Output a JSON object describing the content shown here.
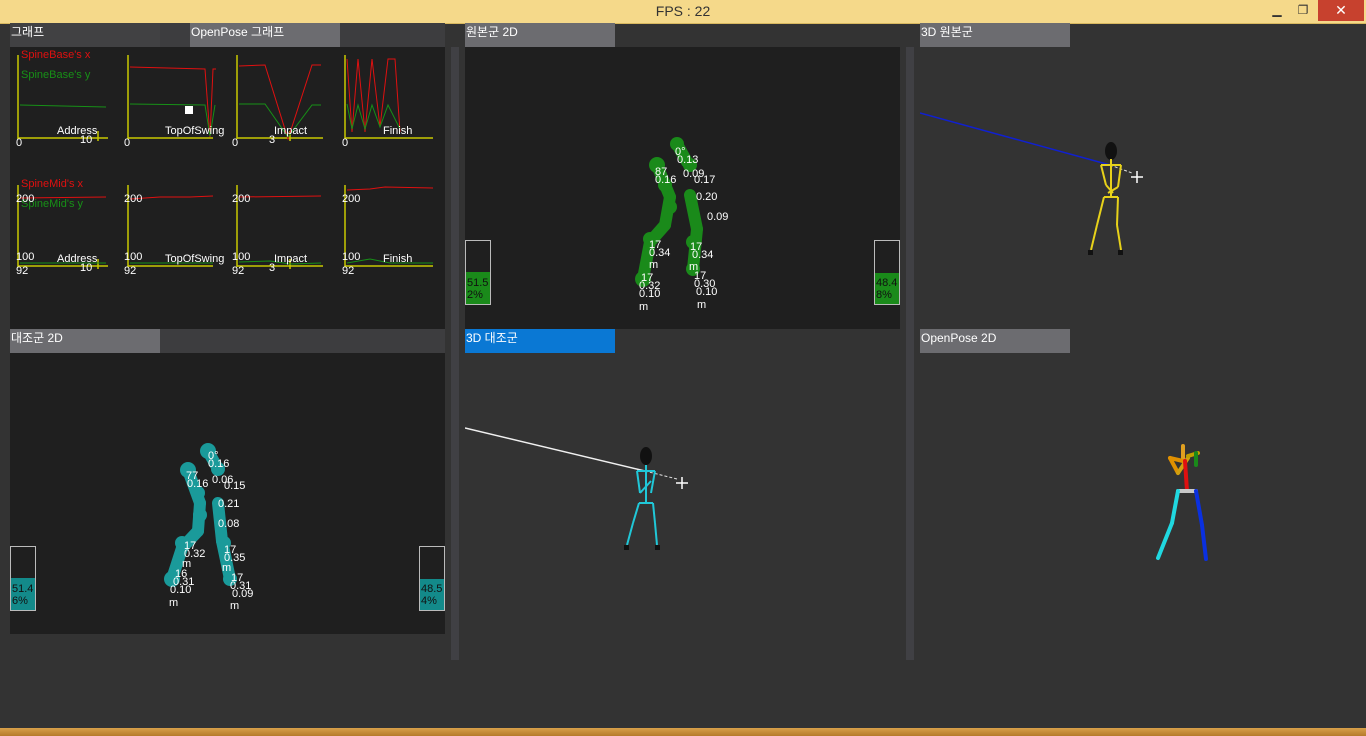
{
  "window": {
    "title": "FPS : 22"
  },
  "tabs": {
    "graph": "그래프",
    "openpose_graph": "OpenPose 그래프",
    "original_2d": "원본군 2D",
    "original_3d": "3D 원본군",
    "control_2d": "대조군 2D",
    "control_3d": "3D 대조군",
    "openpose_2d": "OpenPose 2D"
  },
  "graphs": {
    "row1": {
      "legend_x": "SpineBase's x",
      "legend_y": "SpineBase's y",
      "phases": [
        "Address",
        "TopOfSwing",
        "Impact",
        "Finish"
      ],
      "left_ticks": [
        "0",
        "0",
        "0",
        "0"
      ],
      "extra_ticks": [
        "10",
        "3"
      ]
    },
    "row2": {
      "legend_x": "SpineMid's x",
      "legend_y": "SpineMid's y",
      "phases": [
        "Address",
        "TopOfSwing",
        "Impact",
        "Finish"
      ],
      "top_ticks": [
        "200",
        "200",
        "200",
        "200"
      ],
      "mid_ticks": [
        "100",
        "100",
        "100",
        "100"
      ],
      "bottom_ticks": [
        "92",
        "92",
        "92",
        "92"
      ],
      "extra_ticks": [
        "10",
        "3"
      ]
    }
  },
  "original_2d": {
    "left_bar": {
      "label_line1": "51.5",
      "label_line2": "2%",
      "level_pct": 51.52
    },
    "right_bar": {
      "label_line1": "48.4",
      "label_line2": "8%",
      "level_pct": 48.48
    },
    "joint_labels": [
      "0°",
      "0.13",
      "87",
      "0.16",
      "0.09",
      "0.17",
      "0.20",
      "0.09",
      "17",
      "0.34",
      "m",
      "17",
      "0.34",
      "m",
      "17",
      "0.32",
      "0.10",
      "m",
      "17",
      "0.30",
      "0.10",
      "m"
    ]
  },
  "control_2d": {
    "left_bar": {
      "label_line1": "51.4",
      "label_line2": "6%",
      "level_pct": 51.46
    },
    "right_bar": {
      "label_line1": "48.5",
      "label_line2": "4%",
      "level_pct": 48.54
    },
    "joint_labels": [
      "0°",
      "0.16",
      "77",
      "0.16",
      "0.06",
      "0.15",
      "0.21",
      "0.08",
      "17",
      "0.32",
      "m",
      "17",
      "0.35",
      "m",
      "16",
      "0.31",
      "0.10",
      "m",
      "17",
      "0.31",
      "0.09",
      "m"
    ]
  },
  "colors": {
    "original_skeleton": "#1a8a1a",
    "control_skeleton": "#1a9a9a",
    "line_x": "#e01010",
    "line_y": "#179017",
    "axis": "#c8c800",
    "tab_active": "#0a78d4"
  }
}
